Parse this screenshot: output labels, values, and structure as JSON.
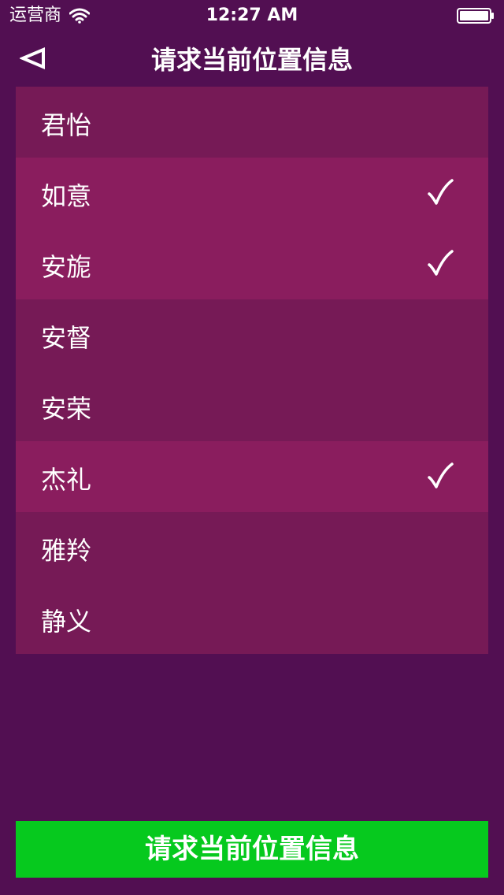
{
  "status_bar": {
    "carrier": "运营商",
    "time": "12:27 AM",
    "wifi_icon": "wifi-icon",
    "battery_icon": "battery-full-icon"
  },
  "nav": {
    "back_icon": "back-triangle-icon",
    "title": "请求当前位置信息"
  },
  "list": {
    "items": [
      {
        "label": "君怡",
        "checked": false
      },
      {
        "label": "如意",
        "checked": true
      },
      {
        "label": "安旎",
        "checked": true
      },
      {
        "label": "安督",
        "checked": false
      },
      {
        "label": "安荣",
        "checked": false
      },
      {
        "label": "杰礼",
        "checked": true
      },
      {
        "label": "雅羚",
        "checked": false
      },
      {
        "label": "静义",
        "checked": false
      }
    ],
    "checkmark_icon": "checkmark-icon"
  },
  "action_button": {
    "label": "请求当前位置信息"
  },
  "colors": {
    "background": "#520f52",
    "row_default": "#761a56",
    "row_selected": "#8a1d5e",
    "button": "#06c91e"
  }
}
